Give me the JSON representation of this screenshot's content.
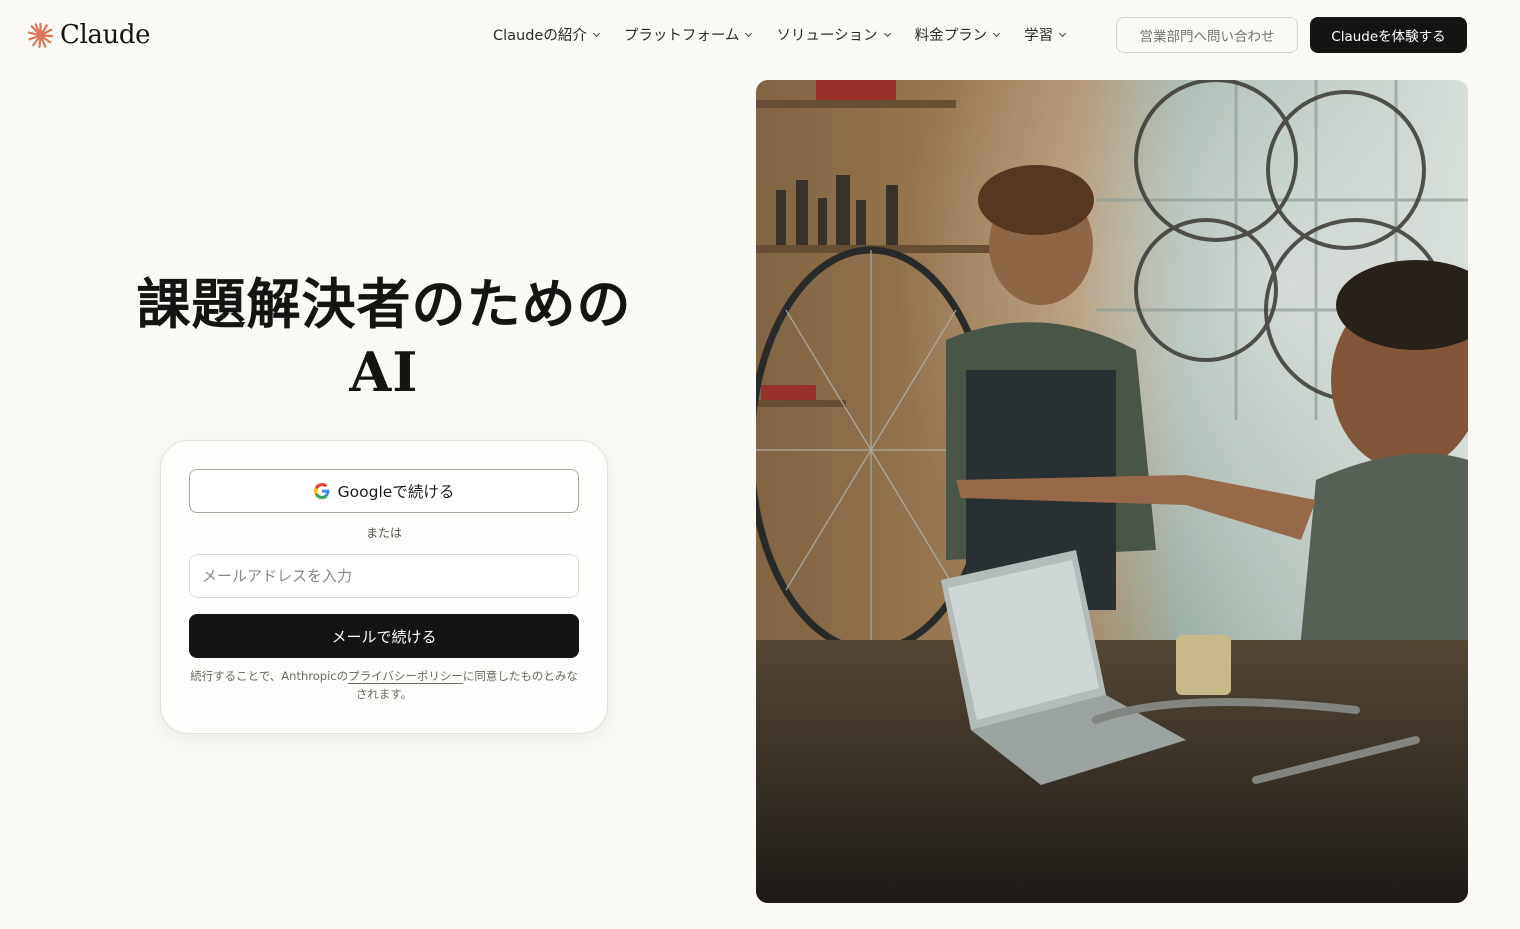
{
  "header": {
    "logo_text": "Claude",
    "nav": [
      {
        "label": "Claudeの紹介"
      },
      {
        "label": "プラットフォーム"
      },
      {
        "label": "ソリューション"
      },
      {
        "label": "料金プラン"
      },
      {
        "label": "学習"
      }
    ],
    "contact_sales_label": "営業部門へ問い合わせ",
    "try_label": "Claudeを体験する"
  },
  "hero": {
    "headline_line1": "課題解決者のための",
    "headline_line2": "AI"
  },
  "login": {
    "google_label": "Googleで続ける",
    "or_label": "または",
    "email_placeholder": "メールアドレスを入力",
    "email_value": "",
    "email_button_label": "メールで続ける",
    "legal_prefix": "続行することで、Anthropicの",
    "legal_link": "プライバシーポリシー",
    "legal_suffix": "に同意したものとみなされます。"
  },
  "colors": {
    "background": "#faf9f5",
    "brand_accent": "#d97757",
    "primary_button": "#141413"
  },
  "icons": {
    "logo": "claude-starburst-icon",
    "nav_chevron": "chevron-down-icon",
    "google": "google-g-icon"
  }
}
